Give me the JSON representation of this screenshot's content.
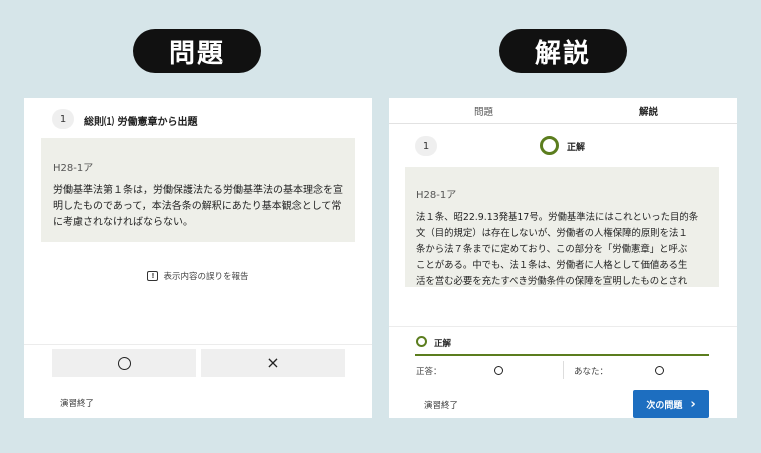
{
  "labels": {
    "left": "問題",
    "right": "解説"
  },
  "question": {
    "number": "1",
    "title": "総則⑴ 労働憲章から出題",
    "code": "H28-1ア",
    "text_lines": [
      "労働基準法第１条は，労働保護法たる労働基準法の基本理念を宣",
      "明したものであって，本法各条の解釈にあたり基本観念として常",
      "に考慮されなければならない。"
    ],
    "report_label": "表示内容の誤りを報告",
    "report_icon": "!",
    "answer_true": "circle-icon",
    "answer_false": "×",
    "end_label": "演習終了"
  },
  "explanation": {
    "tabs": [
      "問題",
      "解説"
    ],
    "number": "1",
    "result": "正解",
    "code": "H28-1ア",
    "text_lines": [
      "法１条、昭22.9.13発基17号。労働基準法にはこれといった目的条",
      "文（目的規定）は存在しないが、労働者の人権保障的原則を法１",
      "条から法７条までに定めており、この部分を「労働憲章」と呼ぶ",
      "ことがある。中でも、法１条は、労働者に人格として価値ある生",
      "活を営む必要を充たすべき労働条件の保障を宣明したものとされ"
    ],
    "result_bar": "正解",
    "correct_label": "正答：",
    "your_label": "あなた：",
    "end_label": "演習終了",
    "next_label": "次の問題",
    "next_arrow": "›",
    "accent": "#5b7d1e",
    "button_color": "#1d6ec0"
  }
}
